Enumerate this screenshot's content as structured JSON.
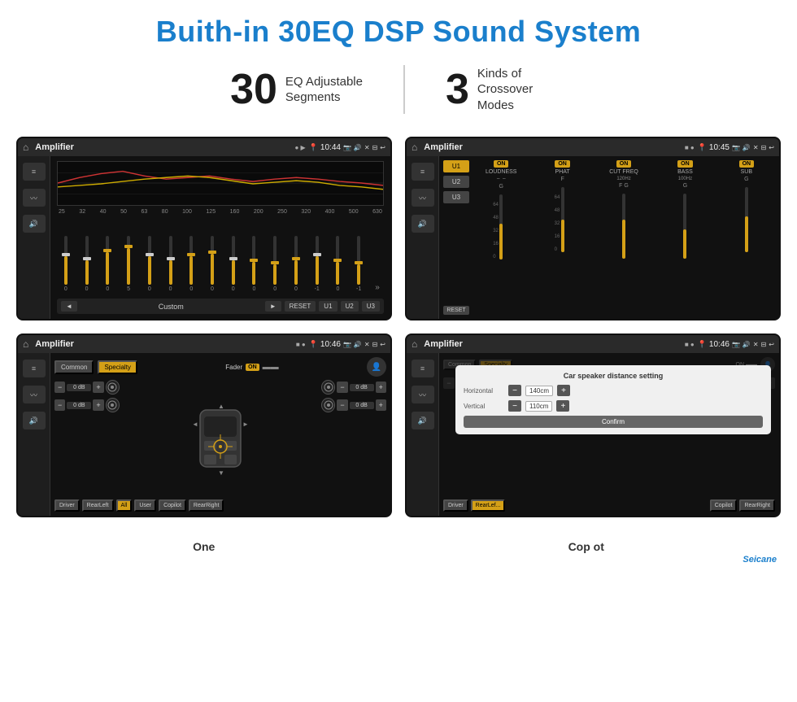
{
  "header": {
    "title": "Buith-in 30EQ DSP Sound System"
  },
  "stats": [
    {
      "number": "30",
      "label": "EQ Adjustable\nSegments"
    },
    {
      "number": "3",
      "label": "Kinds of\nCrossover Modes"
    }
  ],
  "screens": [
    {
      "id": "eq-screen",
      "statusBar": {
        "appName": "Amplifier",
        "time": "10:44"
      },
      "type": "equalizer",
      "freqLabels": [
        "25",
        "32",
        "40",
        "50",
        "63",
        "80",
        "100",
        "125",
        "160",
        "200",
        "250",
        "320",
        "400",
        "500",
        "630"
      ],
      "bottomBar": {
        "prevLabel": "◄",
        "modeName": "Custom",
        "nextLabel": "►",
        "resetBtn": "RESET",
        "u1Btn": "U1",
        "u2Btn": "U2",
        "u3Btn": "U3"
      }
    },
    {
      "id": "crossover-screen",
      "statusBar": {
        "appName": "Amplifier",
        "time": "10:45"
      },
      "type": "crossover",
      "uButtons": [
        "U1",
        "U2",
        "U3"
      ],
      "channels": [
        {
          "label": "ON",
          "name": "LOUDNESS"
        },
        {
          "label": "ON",
          "name": "PHAT"
        },
        {
          "label": "ON",
          "name": "CUT FREQ"
        },
        {
          "label": "ON",
          "name": "BASS"
        },
        {
          "label": "ON",
          "name": "SUB"
        }
      ],
      "resetBtn": "RESET"
    },
    {
      "id": "speaker-screen",
      "statusBar": {
        "appName": "Amplifier",
        "time": "10:46"
      },
      "type": "speaker",
      "modes": [
        "Common",
        "Specialty"
      ],
      "faderLabel": "Fader",
      "onBadge": "ON",
      "dbValues": [
        "0 dB",
        "0 dB",
        "0 dB",
        "0 dB"
      ],
      "buttons": {
        "driver": "Driver",
        "rearLeft": "RearLeft",
        "all": "All",
        "user": "User",
        "copilot": "Copilot",
        "rearRight": "RearRight"
      }
    },
    {
      "id": "distance-screen",
      "statusBar": {
        "appName": "Amplifier",
        "time": "10:46"
      },
      "type": "distance",
      "dialog": {
        "title": "Car speaker distance setting",
        "horizontal": {
          "label": "Horizontal",
          "value": "140cm"
        },
        "vertical": {
          "label": "Vertical",
          "value": "110cm"
        },
        "confirmBtn": "Confirm"
      },
      "buttons": {
        "driver": "Driver",
        "rearLeft": "RearLef...",
        "copilot": "Copilot",
        "rearRight": "RearRight"
      }
    }
  ],
  "bottomLabels": {
    "left": "One",
    "right": "Cop ot"
  },
  "watermark": "Seicane"
}
